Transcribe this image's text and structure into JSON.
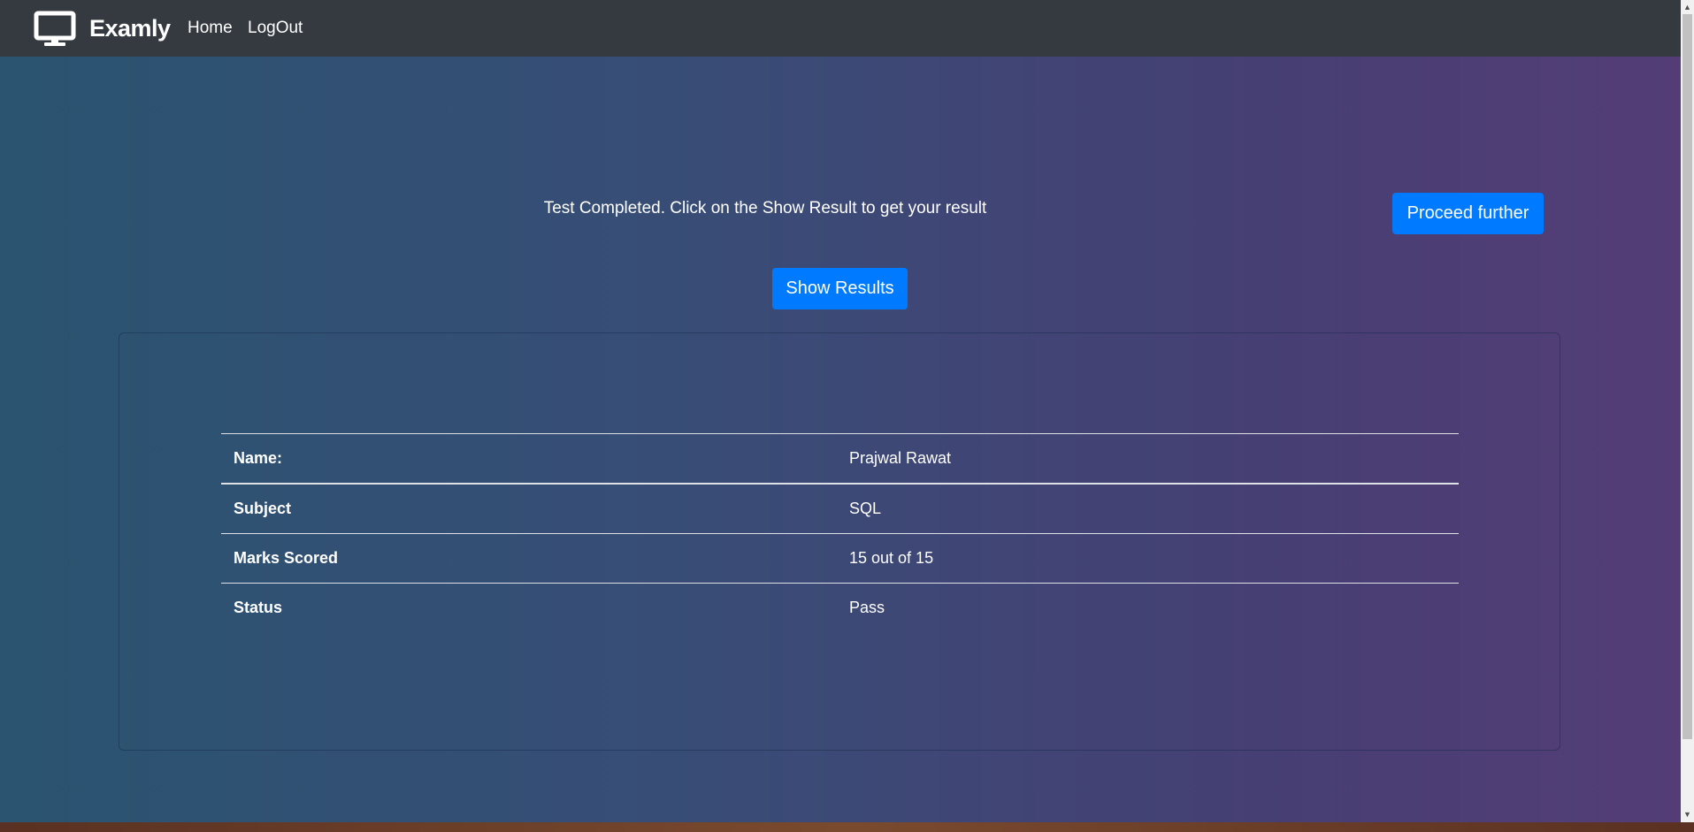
{
  "navbar": {
    "brand": "Examly",
    "brand_icon": "monitor-icon",
    "links": [
      "Home",
      "LogOut"
    ]
  },
  "main": {
    "message": "Test Completed. Click on the Show Result to get your result",
    "proceed_label": "Proceed further",
    "show_results_label": "Show Results"
  },
  "result": {
    "rows": [
      {
        "label": "Name:",
        "value": "Prajwal Rawat"
      },
      {
        "label": "Subject",
        "value": "SQL"
      },
      {
        "label": "Marks Scored",
        "value": "15 out of 15"
      },
      {
        "label": "Status",
        "value": "Pass"
      }
    ]
  },
  "colors": {
    "navbar": "#343a40",
    "button": "#007bff",
    "gradient_start": "#2a5470",
    "gradient_end": "#543d76"
  }
}
